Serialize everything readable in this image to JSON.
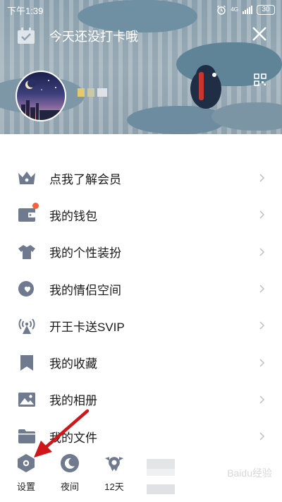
{
  "status_bar": {
    "time": "下午1:39",
    "network": "4G",
    "battery": "30"
  },
  "header": {
    "checkin_text": "今天还没打卡哦",
    "colors": {
      "bg": "#8fa3b0",
      "text": "#ffffff"
    }
  },
  "menu": {
    "items": [
      {
        "label": "点我了解会员",
        "icon": "crown-icon",
        "badge": false
      },
      {
        "label": "我的钱包",
        "icon": "wallet-icon",
        "badge": true
      },
      {
        "label": "我的个性装扮",
        "icon": "tshirt-icon",
        "badge": false
      },
      {
        "label": "我的情侣空间",
        "icon": "couple-heart-icon",
        "badge": false
      },
      {
        "label": "开王卡送SVIP",
        "icon": "antenna-icon",
        "badge": false
      },
      {
        "label": "我的收藏",
        "icon": "bookmark-icon",
        "badge": false
      },
      {
        "label": "我的相册",
        "icon": "photo-icon",
        "badge": false
      },
      {
        "label": "我的文件",
        "icon": "folder-icon",
        "badge": false
      }
    ],
    "colors": {
      "icon": "#6f7a8e",
      "text": "#1a1a1a",
      "chevron": "#c0c0c0",
      "badge": "#f4623b"
    }
  },
  "bottom_bar": {
    "items": [
      {
        "label": "设置",
        "icon": "settings-hex-icon"
      },
      {
        "label": "夜间",
        "icon": "moon-icon"
      },
      {
        "label": "12天",
        "icon": "sun-badge-icon"
      }
    ]
  },
  "annotation": {
    "arrow_color": "#d1161b"
  },
  "watermark": "Baidu经验"
}
